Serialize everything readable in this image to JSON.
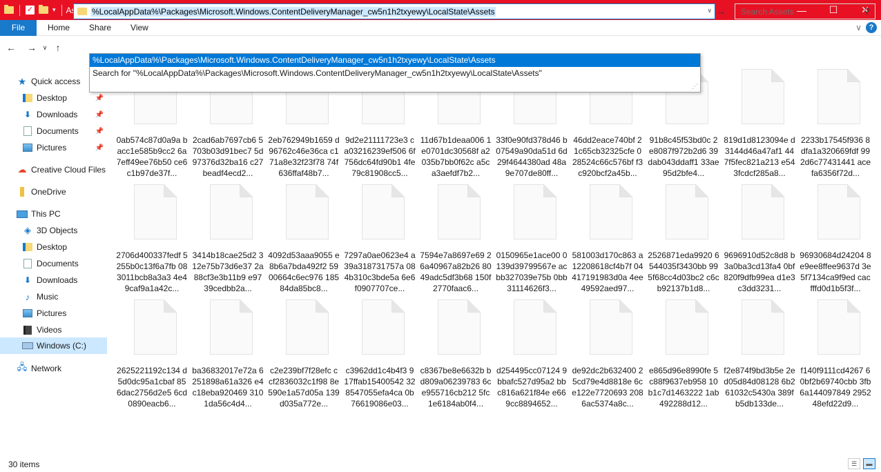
{
  "window": {
    "title": "Assets",
    "controls": {
      "minimize": "—",
      "maximize": "☐",
      "close": "✕"
    }
  },
  "ribbon": {
    "file_tab": "File",
    "tabs": [
      "Home",
      "Share",
      "View"
    ]
  },
  "navbar": {
    "address": "%LocalAppData%\\Packages\\Microsoft.Windows.ContentDeliveryManager_cw5n1h2txyewy\\LocalState\\Assets",
    "search_placeholder": "Search Assets"
  },
  "autocomplete": {
    "items": [
      "%LocalAppData%\\Packages\\Microsoft.Windows.ContentDeliveryManager_cw5n1h2txyewy\\LocalState\\Assets",
      "Search for \"%LocalAppData%\\Packages\\Microsoft.Windows.ContentDeliveryManager_cw5n1h2txyewy\\LocalState\\Assets\""
    ]
  },
  "sidebar": {
    "items": [
      {
        "label": "Quick access",
        "icon": "star-icon"
      },
      {
        "label": "Desktop",
        "icon": "folder-icon",
        "pinned": true
      },
      {
        "label": "Downloads",
        "icon": "download-icon",
        "pinned": true
      },
      {
        "label": "Documents",
        "icon": "document-icon",
        "pinned": true
      },
      {
        "label": "Pictures",
        "icon": "picture-icon",
        "pinned": true
      },
      {
        "label": "Creative Cloud Files",
        "icon": "creative-cloud-icon"
      },
      {
        "label": "OneDrive",
        "icon": "onedrive-icon"
      },
      {
        "label": "This PC",
        "icon": "computer-icon"
      },
      {
        "label": "3D Objects",
        "icon": "cube-icon"
      },
      {
        "label": "Desktop",
        "icon": "folder-icon"
      },
      {
        "label": "Documents",
        "icon": "document-icon"
      },
      {
        "label": "Downloads",
        "icon": "download-icon"
      },
      {
        "label": "Music",
        "icon": "music-icon"
      },
      {
        "label": "Pictures",
        "icon": "picture-icon"
      },
      {
        "label": "Videos",
        "icon": "video-icon"
      },
      {
        "label": "Windows (C:)",
        "icon": "drive-icon",
        "selected": true
      },
      {
        "label": "Network",
        "icon": "network-icon"
      }
    ]
  },
  "files": [
    "0ab574c87d0a9a bacc1e585b9cc2 6a7eff49ee76b50 ce6c1b97de37f...",
    "2cad6ab7697cb6 5703b03d91bec7 5d97376d32ba16 c27beadf4ecd2...",
    "2eb762949b1659 d96762c46e36ca c171a8e32f23f78 74f636ffaf48b7...",
    "9d2e21111723e3 ca03216239ef506 6f756dc64fd90b1 4fe79c81908cc5...",
    "11d67b1deaa006 1e0701dc30568f a2035b7bb0f62c a5ca3aefdf7b2...",
    "33f0e90fd378d46 b07549a90da51d 6d29f4644380ad 48a9e707de80ff...",
    "46dd2eace740bf 21c65cb32325cfe 028524c66c576bf f3c920bcf2a45b...",
    "91b8c45f53bd0c 2e8087f972b2d6 39dab043ddaff1 33ae95d2bfe4...",
    "819d1d8123094e d3144d46a47af1 447f5fec821a213 e543fcdcf285a8...",
    "2233b17545f936 8dfa1a320669fdf 992d6c77431441 acefa6356f72d...",
    "2706d400337fedf 5255b0c13f6a7fb 083011bcb8a3a3 4e49caf9a1a42c...",
    "3414b18cae25d2 312e75b73d6e37 2a88cf3e3b11b9 e9739cedbb2a...",
    "4092d53aaa9055 e8b6a7bda492f2 5900664c6ec976 18584da85bc8...",
    "7297a0ae0623e4 a39a318731757a 084b310c3bde5a 6e6f0907707ce...",
    "7594e7a8697e69 26a40967a82b26 8049adc5df3b68 150f2770faac6...",
    "0150965e1ace00 0139d39799567e acbb327039e75b 0bb31114626f3...",
    "581003d170c863 a12208618cf4b7f 04417191983d0a 4ee49592aed97...",
    "2526871eda9920 6544035f3430bb 995f68cc4d03bc2 c6cb92137b1d8...",
    "9696910d52c8d8 b3a0ba3cd13fa4 0bf820f9dfb99ea d1e3c3dd3231...",
    "96930684d24204 8e9ee8ffee9637d 3e5f7134ca9f9ed cacfffd0d1b5f3f...",
    "2625221192c134 d5d0dc95a1cbaf 856dac2756d2e5 6cd0890eacb6...",
    "ba36832017e72a 6251898a61a326 e4c18eba920469 3101da56c4d4...",
    "c2e239bf7f28efc ccf2836032c1f98 8e590e1a57d05a 139d035a772e...",
    "c3962dd1c4b4f3 917ffab15400542 328547055efa4ca 0b76619086e03...",
    "c8367be8e6632b bd809a06239783 6ce955716cb212 5fc1e6184ab0f4...",
    "d254495cc07124 9bbafc527d95a2 bbc816a621f84e e669cc8894652...",
    "de92dc2b632400 25cd79e4d8818e 6ce122e7720693 2086ac5374a8c...",
    "e865d96e8990fe 5c88f9637eb958 10b1c7d1463222 1ab492288d12...",
    "f2e874f9bd3b5e 2ed05d84d08128 6b261032c5430a 389fb5db133de...",
    "f140f9111cd4267 60bf2b69740cbb 3fb6a144097849 295248efd22d9..."
  ],
  "status": {
    "item_count": "30 items"
  },
  "colors": {
    "titlebar": "#e81123",
    "accent": "#1979ca",
    "selection": "#0078d7"
  }
}
